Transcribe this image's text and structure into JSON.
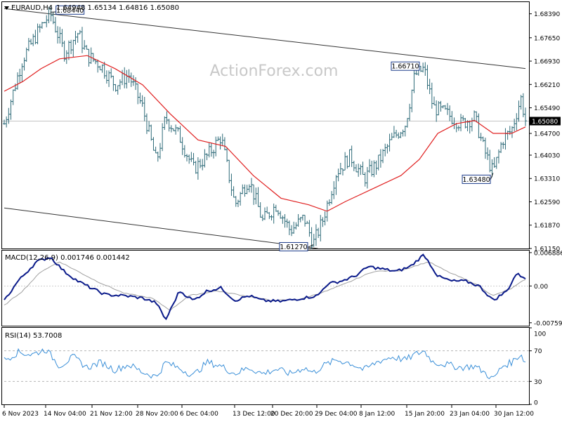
{
  "header": {
    "symbol": "EURAUD,H4",
    "ohlc": "1.64948 1.65134 1.64816 1.65080"
  },
  "watermark": "ActionForex.com",
  "colors": {
    "candle": "#2d6a78",
    "ma": "#e02020",
    "macd": "#0a1a8a",
    "signal": "#a0a0a0",
    "rsi": "#3a8fd8",
    "channel": "#333333",
    "grid": "#cccccc"
  },
  "x_axis_labels": [
    "6 Nov 2023",
    "14 Nov 04:00",
    "21 Nov 12:00",
    "28 Nov 20:00",
    "6 Dec 04:00",
    "13 Dec 12:00",
    "20 Dec 20:00",
    "29 Dec 04:00",
    "8 Jan 12:00",
    "15 Jan 20:00",
    "23 Jan 04:00",
    "30 Jan 12:00"
  ],
  "chart_data": [
    {
      "type": "candlestick",
      "title": "EURAUD,H4",
      "y_ticks": [
        "1.68390",
        "1.67650",
        "1.66930",
        "1.66210",
        "1.65490",
        "1.64700",
        "1.64030",
        "1.63310",
        "1.62590",
        "1.61870",
        "1.61150"
      ],
      "ylim": [
        1.6115,
        1.6875
      ],
      "current_price_label": "1.65080",
      "annotations": [
        {
          "label": "1.68440",
          "value": 1.6844
        },
        {
          "label": "1.66710",
          "value": 1.6671
        },
        {
          "label": "1.63480",
          "value": 1.6348
        },
        {
          "label": "1.61270",
          "value": 1.6127
        }
      ],
      "price_path": [
        {
          "x": 0,
          "y": 1.65
        },
        {
          "x": 4,
          "y": 1.67
        },
        {
          "x": 8,
          "y": 1.68
        },
        {
          "x": 10,
          "y": 1.684
        },
        {
          "x": 13,
          "y": 1.672
        },
        {
          "x": 16,
          "y": 1.678
        },
        {
          "x": 18,
          "y": 1.671
        },
        {
          "x": 21,
          "y": 1.668
        },
        {
          "x": 24,
          "y": 1.662
        },
        {
          "x": 27,
          "y": 1.665
        },
        {
          "x": 30,
          "y": 1.655
        },
        {
          "x": 33,
          "y": 1.638
        },
        {
          "x": 35,
          "y": 1.652
        },
        {
          "x": 38,
          "y": 1.646
        },
        {
          "x": 41,
          "y": 1.636
        },
        {
          "x": 44,
          "y": 1.64
        },
        {
          "x": 47,
          "y": 1.646
        },
        {
          "x": 50,
          "y": 1.625
        },
        {
          "x": 53,
          "y": 1.633
        },
        {
          "x": 56,
          "y": 1.62
        },
        {
          "x": 59,
          "y": 1.625
        },
        {
          "x": 62,
          "y": 1.617
        },
        {
          "x": 65,
          "y": 1.621
        },
        {
          "x": 67,
          "y": 1.613
        },
        {
          "x": 69,
          "y": 1.62
        },
        {
          "x": 72,
          "y": 1.635
        },
        {
          "x": 75,
          "y": 1.64
        },
        {
          "x": 78,
          "y": 1.633
        },
        {
          "x": 81,
          "y": 1.638
        },
        {
          "x": 84,
          "y": 1.645
        },
        {
          "x": 87,
          "y": 1.65
        },
        {
          "x": 89,
          "y": 1.665
        },
        {
          "x": 91,
          "y": 1.667
        },
        {
          "x": 93,
          "y": 1.655
        },
        {
          "x": 96,
          "y": 1.653
        },
        {
          "x": 99,
          "y": 1.65
        },
        {
          "x": 102,
          "y": 1.652
        },
        {
          "x": 104,
          "y": 1.642
        },
        {
          "x": 106,
          "y": 1.6348
        },
        {
          "x": 108,
          "y": 1.645
        },
        {
          "x": 110,
          "y": 1.648
        },
        {
          "x": 112,
          "y": 1.658
        },
        {
          "x": 113,
          "y": 1.651
        }
      ],
      "ma_path": [
        {
          "x": 0,
          "y": 1.66
        },
        {
          "x": 4,
          "y": 1.663
        },
        {
          "x": 8,
          "y": 1.667
        },
        {
          "x": 12,
          "y": 1.67
        },
        {
          "x": 18,
          "y": 1.671
        },
        {
          "x": 24,
          "y": 1.667
        },
        {
          "x": 30,
          "y": 1.662
        },
        {
          "x": 36,
          "y": 1.653
        },
        {
          "x": 42,
          "y": 1.645
        },
        {
          "x": 48,
          "y": 1.643
        },
        {
          "x": 54,
          "y": 1.634
        },
        {
          "x": 60,
          "y": 1.627
        },
        {
          "x": 66,
          "y": 1.625
        },
        {
          "x": 70,
          "y": 1.623
        },
        {
          "x": 74,
          "y": 1.626
        },
        {
          "x": 80,
          "y": 1.63
        },
        {
          "x": 86,
          "y": 1.634
        },
        {
          "x": 90,
          "y": 1.639
        },
        {
          "x": 94,
          "y": 1.647
        },
        {
          "x": 98,
          "y": 1.65
        },
        {
          "x": 102,
          "y": 1.651
        },
        {
          "x": 106,
          "y": 1.647
        },
        {
          "x": 110,
          "y": 1.647
        },
        {
          "x": 113,
          "y": 1.649
        }
      ],
      "channel_lines": [
        {
          "from": {
            "x": 0,
            "y": 1.6855
          },
          "to": {
            "x": 113,
            "y": 1.667
          }
        },
        {
          "from": {
            "x": 0,
            "y": 1.624
          },
          "to": {
            "x": 68,
            "y": 1.6115
          }
        }
      ]
    },
    {
      "type": "line",
      "title": "MACD(12,26,9) 0.001746 0.001442",
      "y_ticks": [
        "0.006886",
        "0.00",
        "-0.007591"
      ],
      "ylim": [
        -0.0082,
        0.0073
      ],
      "series": [
        {
          "name": "MACD",
          "points": [
            {
              "x": 0,
              "y": -0.003
            },
            {
              "x": 3,
              "y": 0.001
            },
            {
              "x": 7,
              "y": 0.005
            },
            {
              "x": 10,
              "y": 0.006
            },
            {
              "x": 13,
              "y": 0.003
            },
            {
              "x": 16,
              "y": 0.001
            },
            {
              "x": 19,
              "y": -0.0005
            },
            {
              "x": 22,
              "y": -0.0018
            },
            {
              "x": 26,
              "y": -0.002
            },
            {
              "x": 30,
              "y": -0.0025
            },
            {
              "x": 33,
              "y": -0.0035
            },
            {
              "x": 35,
              "y": -0.007
            },
            {
              "x": 38,
              "y": -0.001
            },
            {
              "x": 41,
              "y": -0.003
            },
            {
              "x": 44,
              "y": -0.001
            },
            {
              "x": 47,
              "y": -0.0004
            },
            {
              "x": 50,
              "y": -0.003
            },
            {
              "x": 53,
              "y": -0.002
            },
            {
              "x": 56,
              "y": -0.003
            },
            {
              "x": 60,
              "y": -0.0032
            },
            {
              "x": 64,
              "y": -0.0026
            },
            {
              "x": 68,
              "y": -0.002
            },
            {
              "x": 70,
              "y": 0.0004
            },
            {
              "x": 73,
              "y": 0.001
            },
            {
              "x": 76,
              "y": 0.002
            },
            {
              "x": 79,
              "y": 0.004
            },
            {
              "x": 82,
              "y": 0.0035
            },
            {
              "x": 85,
              "y": 0.003
            },
            {
              "x": 88,
              "y": 0.004
            },
            {
              "x": 91,
              "y": 0.0065
            },
            {
              "x": 94,
              "y": 0.002
            },
            {
              "x": 97,
              "y": 0.001
            },
            {
              "x": 100,
              "y": 0.001
            },
            {
              "x": 103,
              "y": 0.0
            },
            {
              "x": 106,
              "y": -0.003
            },
            {
              "x": 109,
              "y": -0.001
            },
            {
              "x": 111,
              "y": 0.0025
            },
            {
              "x": 113,
              "y": 0.0017
            }
          ]
        },
        {
          "name": "Signal",
          "points": [
            {
              "x": 0,
              "y": -0.004
            },
            {
              "x": 4,
              "y": -0.001
            },
            {
              "x": 8,
              "y": 0.003
            },
            {
              "x": 12,
              "y": 0.005
            },
            {
              "x": 16,
              "y": 0.003
            },
            {
              "x": 20,
              "y": 0.001
            },
            {
              "x": 26,
              "y": -0.0015
            },
            {
              "x": 32,
              "y": -0.0025
            },
            {
              "x": 36,
              "y": -0.005
            },
            {
              "x": 40,
              "y": -0.002
            },
            {
              "x": 46,
              "y": -0.001
            },
            {
              "x": 52,
              "y": -0.002
            },
            {
              "x": 58,
              "y": -0.003
            },
            {
              "x": 64,
              "y": -0.0028
            },
            {
              "x": 70,
              "y": -0.001
            },
            {
              "x": 74,
              "y": 0.0005
            },
            {
              "x": 80,
              "y": 0.003
            },
            {
              "x": 86,
              "y": 0.0032
            },
            {
              "x": 92,
              "y": 0.005
            },
            {
              "x": 96,
              "y": 0.003
            },
            {
              "x": 102,
              "y": 0.0005
            },
            {
              "x": 106,
              "y": -0.002
            },
            {
              "x": 110,
              "y": -0.0005
            },
            {
              "x": 113,
              "y": 0.0014
            }
          ]
        }
      ]
    },
    {
      "type": "line",
      "title": "RSI(14) 53.7008",
      "y_ticks": [
        "100",
        "70",
        "30",
        "0"
      ],
      "ylim": [
        0,
        100
      ],
      "levels": [
        70,
        30
      ],
      "series": [
        {
          "name": "RSI",
          "points": [
            {
              "x": 0,
              "y": 58
            },
            {
              "x": 3,
              "y": 68
            },
            {
              "x": 6,
              "y": 65
            },
            {
              "x": 9,
              "y": 72
            },
            {
              "x": 12,
              "y": 50
            },
            {
              "x": 15,
              "y": 62
            },
            {
              "x": 18,
              "y": 48
            },
            {
              "x": 21,
              "y": 55
            },
            {
              "x": 24,
              "y": 45
            },
            {
              "x": 27,
              "y": 52
            },
            {
              "x": 30,
              "y": 42
            },
            {
              "x": 33,
              "y": 36
            },
            {
              "x": 35,
              "y": 55
            },
            {
              "x": 38,
              "y": 47
            },
            {
              "x": 41,
              "y": 38
            },
            {
              "x": 44,
              "y": 55
            },
            {
              "x": 47,
              "y": 50
            },
            {
              "x": 50,
              "y": 40
            },
            {
              "x": 53,
              "y": 48
            },
            {
              "x": 56,
              "y": 40
            },
            {
              "x": 59,
              "y": 46
            },
            {
              "x": 62,
              "y": 40
            },
            {
              "x": 65,
              "y": 48
            },
            {
              "x": 67,
              "y": 41
            },
            {
              "x": 69,
              "y": 50
            },
            {
              "x": 72,
              "y": 58
            },
            {
              "x": 75,
              "y": 54
            },
            {
              "x": 78,
              "y": 45
            },
            {
              "x": 81,
              "y": 56
            },
            {
              "x": 84,
              "y": 62
            },
            {
              "x": 87,
              "y": 58
            },
            {
              "x": 89,
              "y": 65
            },
            {
              "x": 91,
              "y": 70
            },
            {
              "x": 93,
              "y": 55
            },
            {
              "x": 96,
              "y": 52
            },
            {
              "x": 99,
              "y": 48
            },
            {
              "x": 102,
              "y": 50
            },
            {
              "x": 104,
              "y": 42
            },
            {
              "x": 106,
              "y": 33
            },
            {
              "x": 108,
              "y": 50
            },
            {
              "x": 110,
              "y": 55
            },
            {
              "x": 112,
              "y": 66
            },
            {
              "x": 113,
              "y": 54
            }
          ]
        }
      ]
    }
  ]
}
